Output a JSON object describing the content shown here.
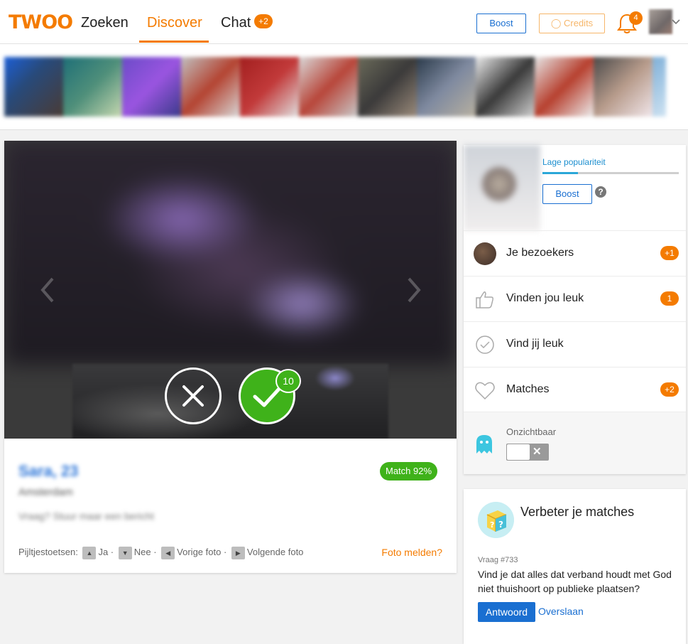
{
  "header": {
    "logo": "TWOO",
    "nav": [
      {
        "label": "Zoeken"
      },
      {
        "label": "Discover"
      },
      {
        "label": "Chat"
      }
    ],
    "chat_badge": "+2",
    "boost_label": "Boost",
    "credits_label": "Credits",
    "notifications_count": "4",
    "accent_color": "#f47b00"
  },
  "profile": {
    "like_count": "10",
    "name": "Sara, 23",
    "location": "Amsterdam",
    "status": "Vraag? Stuur maar een bericht",
    "match_label": "Match 92%",
    "keys_label": "Pijltjestoetsen:",
    "key_yes": "Ja",
    "key_no": "Nee",
    "key_prev": "Vorige foto",
    "key_next": "Volgende foto",
    "report_label": "Foto melden?"
  },
  "sidebar": {
    "popularity_label": "Lage populariteit",
    "popularity_level": 0.26,
    "boost_label": "Boost",
    "help_label": "?",
    "rows": [
      {
        "label": "Je bezoekers",
        "badge": "+1"
      },
      {
        "label": "Vinden jou leuk",
        "badge": "1"
      },
      {
        "label": "Vind jij leuk",
        "badge": ""
      },
      {
        "label": "Matches",
        "badge": "+2"
      }
    ],
    "invisible_label": "Onzichtbaar"
  },
  "improve": {
    "title": "Verbeter je matches",
    "question_number": "Vraag #733",
    "question": "Vind je dat alles dat verband houdt met God niet thuishoort op publieke plaatsen?",
    "answer_label": "Antwoord",
    "skip_label": "Overslaan"
  }
}
